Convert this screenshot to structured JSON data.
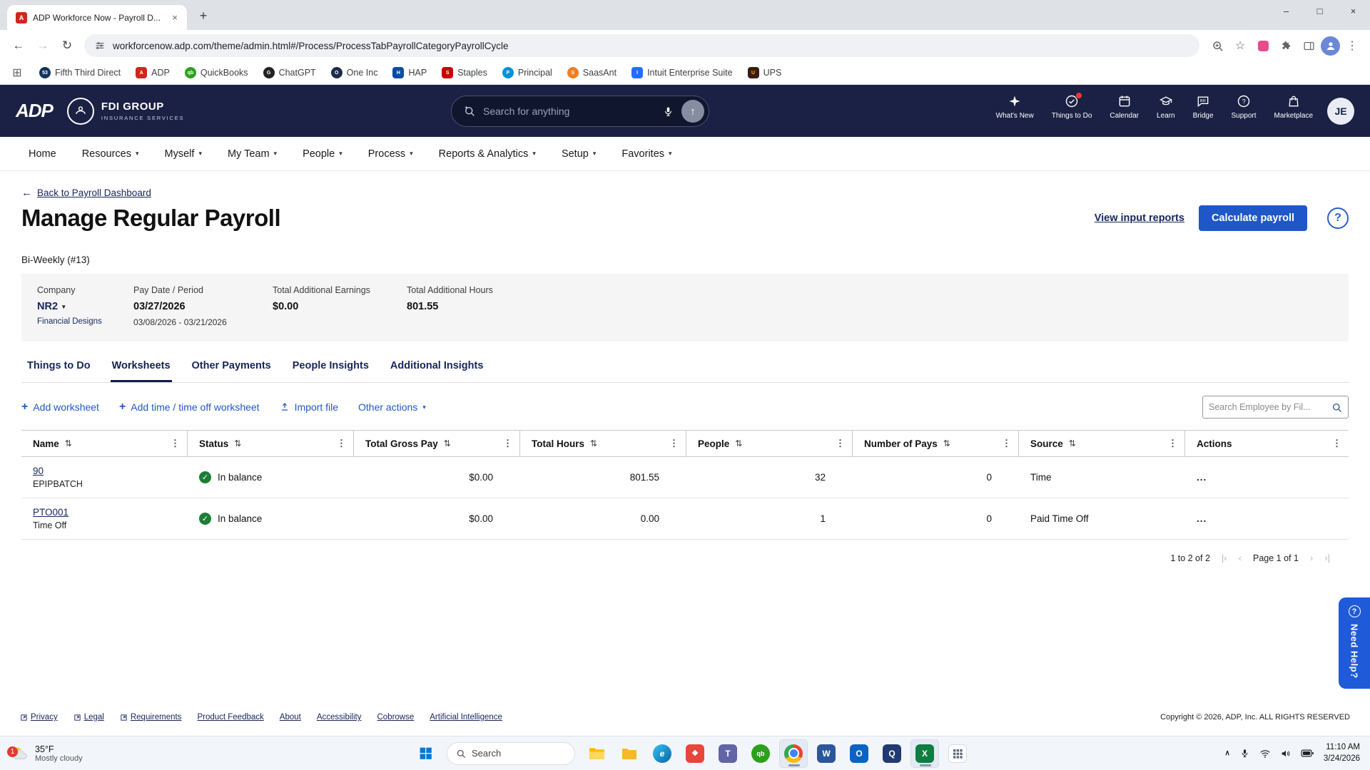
{
  "theme": {
    "navy": "#1b2144",
    "accent": "#1f57c8",
    "link-navy": "#17255c",
    "success": "#1e7d34"
  },
  "icons": {
    "sort": "⇅",
    "kebab": "⋮",
    "caret": "▾",
    "back": "←",
    "plus": "+",
    "check": "✓",
    "first": "|‹",
    "prev": "‹",
    "next": "›",
    "last": "›|",
    "up": "↑",
    "apps": "⊞",
    "star": "☆",
    "refresh": "↻",
    "forward": "→",
    "back_nav": "←",
    "minimize": "–",
    "maximize": "□",
    "close": "×",
    "new_tab": "+",
    "menu": "⋮",
    "chevron_up": "∧",
    "question": "?"
  },
  "browser": {
    "tab_title": "ADP Workforce Now - Payroll D...",
    "url": "workforcenow.adp.com/theme/admin.html#/Process/ProcessTabPayrollCategoryPayrollCycle",
    "bookmarks": [
      "Fifth Third Direct",
      "ADP",
      "QuickBooks",
      "ChatGPT",
      "One Inc",
      "HAP",
      "Staples",
      "Principal",
      "SaasAnt",
      "Intuit Enterprise Suite",
      "UPS"
    ]
  },
  "header": {
    "logo": "ADP",
    "company_name": "FDI GROUP",
    "company_tagline": "INSURANCE SERVICES",
    "search_placeholder": "Search for anything",
    "items": [
      {
        "label": "What's New"
      },
      {
        "label": "Things to Do"
      },
      {
        "label": "Calendar"
      },
      {
        "label": "Learn"
      },
      {
        "label": "Bridge"
      },
      {
        "label": "Support"
      },
      {
        "label": "Marketplace"
      }
    ],
    "avatar": "JE"
  },
  "nav": [
    "Home",
    "Resources",
    "Myself",
    "My Team",
    "People",
    "Process",
    "Reports & Analytics",
    "Setup",
    "Favorites"
  ],
  "page": {
    "back_link": "Back to Payroll Dashboard",
    "title": "Manage Regular Payroll",
    "view_reports": "View input reports",
    "calculate_button": "Calculate payroll",
    "cycle": "Bi-Weekly (#13)",
    "summary": {
      "company_label": "Company",
      "company": "NR2",
      "company_link": "Financial Designs",
      "pay_label": "Pay Date / Period",
      "pay_date": "03/27/2026",
      "pay_period": "03/08/2026 - 03/21/2026",
      "earnings_label": "Total Additional Earnings",
      "earnings": "$0.00",
      "hours_label": "Total Additional Hours",
      "hours": "801.55"
    },
    "tabs": [
      "Things to Do",
      "Worksheets",
      "Other Payments",
      "People Insights",
      "Additional Insights"
    ],
    "actions": {
      "add_worksheet": "Add worksheet",
      "add_time": "Add time / time off worksheet",
      "import_file": "Import file",
      "other": "Other actions",
      "search_placeholder": "Search Employee by Fil..."
    },
    "table": {
      "columns": [
        "Name",
        "Status",
        "Total Gross Pay",
        "Total Hours",
        "People",
        "Number of Pays",
        "Source",
        "Actions"
      ],
      "rows": [
        {
          "name": "90",
          "sub": "EPIPBATCH",
          "status": "In balance",
          "gross": "$0.00",
          "hours": "801.55",
          "people": "32",
          "pays": "0",
          "source": "Time",
          "actions": "..."
        },
        {
          "name": "PTO001",
          "sub": "Time Off",
          "status": "In balance",
          "gross": "$0.00",
          "hours": "0.00",
          "people": "1",
          "pays": "0",
          "source": "Paid Time Off",
          "actions": "..."
        }
      ],
      "range": "1 to 2 of 2",
      "page": "Page 1 of 1"
    },
    "need_help": "Need Help?"
  },
  "footer": {
    "links": [
      "Privacy",
      "Legal",
      "Requirements",
      "Product Feedback",
      "About",
      "Accessibility",
      "Cobrowse",
      "Artificial Intelligence"
    ],
    "copyright": "Copyright © 2026, ADP, Inc. ALL RIGHTS RESERVED"
  },
  "taskbar": {
    "weather_temp": "35°F",
    "weather_desc": "Mostly cloudy",
    "badge": "1",
    "search_placeholder": "Search",
    "time": "11:10 AM",
    "date": "3/24/2026"
  }
}
